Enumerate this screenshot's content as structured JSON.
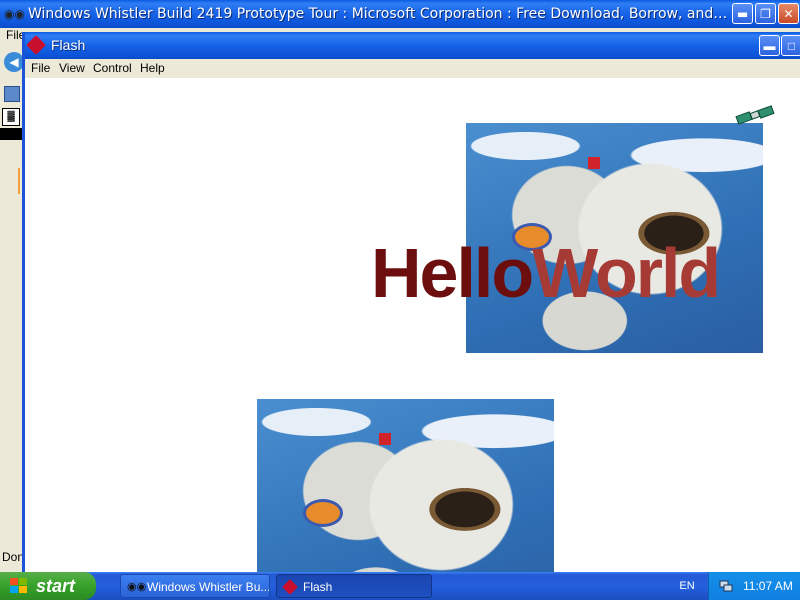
{
  "browser": {
    "title": "Windows Whistler Build 2419 Prototype Tour : Microsoft Corporation : Free Download, Borrow, and Streaming...",
    "menu_file_partial": "File",
    "status_partial": "Don"
  },
  "flash": {
    "title": "Flash",
    "menu": [
      "File",
      "View",
      "Control",
      "Help"
    ],
    "text_part1": "Hello",
    "text_part2": "World"
  },
  "taskbar": {
    "start_label": "start",
    "tasks": [
      {
        "label": "Windows Whistler Bu...",
        "icon": "browser-icon"
      },
      {
        "label": "Flash",
        "icon": "flash-icon"
      }
    ],
    "language": "EN",
    "clock": "11:07 AM"
  },
  "colors": {
    "titlebar": "#1663e8",
    "hello": "#6d0e0e",
    "world": "#a63a34",
    "start": "#36a12a"
  }
}
